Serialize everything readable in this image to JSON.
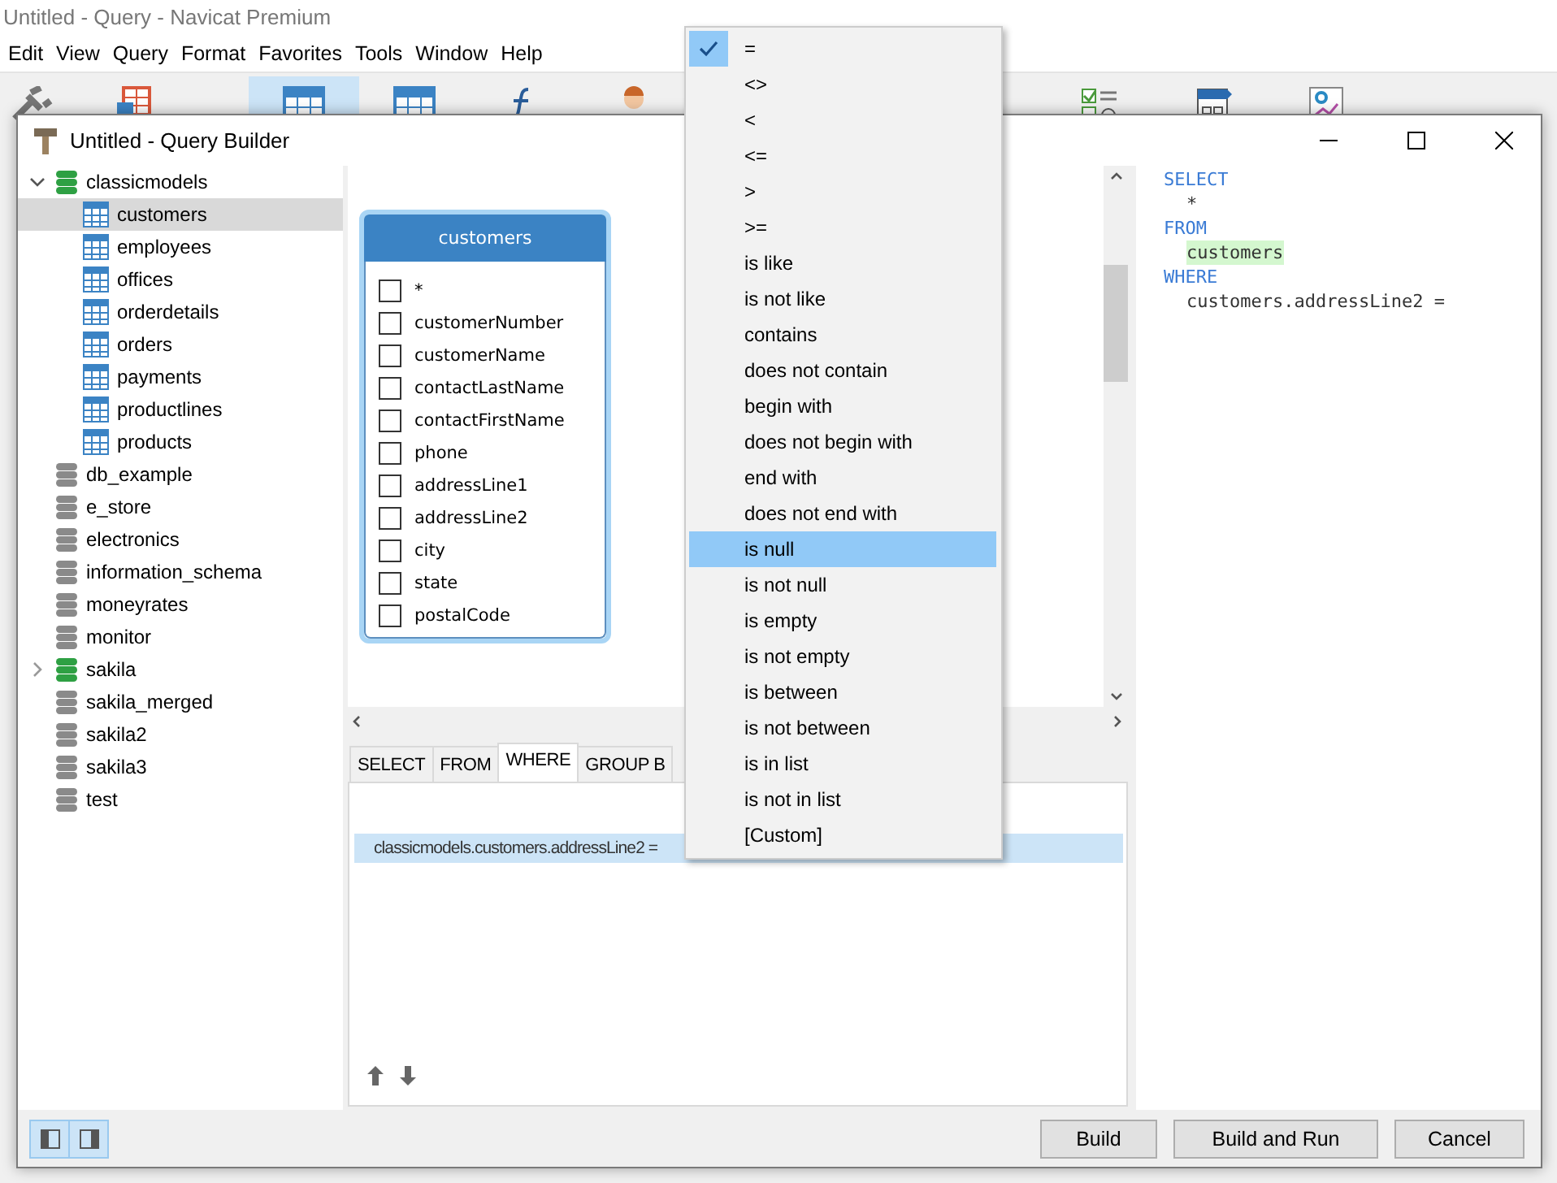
{
  "app_window": {
    "title": "Untitled - Query - Navicat Premium",
    "menu": [
      "Edit",
      "View",
      "Query",
      "Format",
      "Favorites",
      "Tools",
      "Window",
      "Help"
    ]
  },
  "dialog": {
    "title": "Untitled - Query Builder"
  },
  "tree": [
    {
      "label": "classicmodels",
      "open": true,
      "has_children": true,
      "expanded": true,
      "children": [
        {
          "label": "customers",
          "selected": true
        },
        {
          "label": "employees",
          "selected": false
        },
        {
          "label": "offices",
          "selected": false
        },
        {
          "label": "orderdetails",
          "selected": false
        },
        {
          "label": "orders",
          "selected": false
        },
        {
          "label": "payments",
          "selected": false
        },
        {
          "label": "productlines",
          "selected": false
        },
        {
          "label": "products",
          "selected": false
        }
      ]
    },
    {
      "label": "db_example",
      "open": false,
      "has_children": false
    },
    {
      "label": "e_store",
      "open": false,
      "has_children": false
    },
    {
      "label": "electronics",
      "open": false,
      "has_children": false
    },
    {
      "label": "information_schema",
      "open": false,
      "has_children": false
    },
    {
      "label": "moneyrates",
      "open": false,
      "has_children": false
    },
    {
      "label": "monitor",
      "open": false,
      "has_children": false
    },
    {
      "label": "sakila",
      "open": true,
      "has_children": true,
      "expanded": false
    },
    {
      "label": "sakila_merged",
      "open": false,
      "has_children": false
    },
    {
      "label": "sakila2",
      "open": false,
      "has_children": false
    },
    {
      "label": "sakila3",
      "open": false,
      "has_children": false
    },
    {
      "label": "test",
      "open": false,
      "has_children": false
    }
  ],
  "table_card": {
    "title": "customers",
    "fields": [
      {
        "name": "*",
        "checked": false
      },
      {
        "name": "customerNumber",
        "checked": false
      },
      {
        "name": "customerName",
        "checked": false
      },
      {
        "name": "contactLastName",
        "checked": false
      },
      {
        "name": "contactFirstName",
        "checked": false
      },
      {
        "name": "phone",
        "checked": false
      },
      {
        "name": "addressLine1",
        "checked": false
      },
      {
        "name": "addressLine2",
        "checked": false
      },
      {
        "name": "city",
        "checked": false
      },
      {
        "name": "state",
        "checked": false
      },
      {
        "name": "postalCode",
        "checked": false
      }
    ]
  },
  "clause_tabs": [
    {
      "label": "SELECT",
      "selected": false
    },
    {
      "label": "FROM",
      "selected": false
    },
    {
      "label": "WHERE",
      "selected": true
    },
    {
      "label": "GROUP B",
      "selected": false
    }
  ],
  "where_rows": [
    {
      "text": "classicmodels.customers.addressLine2 =",
      "selected": true
    }
  ],
  "sql": [
    {
      "text": "SELECT",
      "kind": "keyword"
    },
    {
      "text": "*",
      "kind": "item"
    },
    {
      "text": "FROM",
      "kind": "keyword"
    },
    {
      "text": "customers",
      "kind": "table"
    },
    {
      "text": "WHERE",
      "kind": "keyword"
    },
    {
      "text": "customers.addressLine2 =",
      "kind": "item"
    }
  ],
  "layout_toggles": [
    {
      "kind": "left",
      "selected": true
    },
    {
      "kind": "right",
      "selected": true
    }
  ],
  "buttons": [
    "Build",
    "Build and Run",
    "Cancel"
  ],
  "operator_menu": [
    {
      "label": "=",
      "selected": true,
      "highlighted": false
    },
    {
      "label": "<>",
      "selected": false,
      "highlighted": false
    },
    {
      "label": "<",
      "selected": false,
      "highlighted": false
    },
    {
      "label": "<=",
      "selected": false,
      "highlighted": false
    },
    {
      "label": ">",
      "selected": false,
      "highlighted": false
    },
    {
      "label": ">=",
      "selected": false,
      "highlighted": false
    },
    {
      "label": "is like",
      "selected": false,
      "highlighted": false
    },
    {
      "label": "is not like",
      "selected": false,
      "highlighted": false
    },
    {
      "label": "contains",
      "selected": false,
      "highlighted": false
    },
    {
      "label": "does not contain",
      "selected": false,
      "highlighted": false
    },
    {
      "label": "begin with",
      "selected": false,
      "highlighted": false
    },
    {
      "label": "does not begin with",
      "selected": false,
      "highlighted": false
    },
    {
      "label": "end with",
      "selected": false,
      "highlighted": false
    },
    {
      "label": "does not end with",
      "selected": false,
      "highlighted": false
    },
    {
      "label": "is null",
      "selected": false,
      "highlighted": true
    },
    {
      "label": "is not null",
      "selected": false,
      "highlighted": false
    },
    {
      "label": "is empty",
      "selected": false,
      "highlighted": false
    },
    {
      "label": "is not empty",
      "selected": false,
      "highlighted": false
    },
    {
      "label": "is between",
      "selected": false,
      "highlighted": false
    },
    {
      "label": "is not between",
      "selected": false,
      "highlighted": false
    },
    {
      "label": "is in list",
      "selected": false,
      "highlighted": false
    },
    {
      "label": "is not in list",
      "selected": false,
      "highlighted": false
    },
    {
      "label": "[Custom]",
      "selected": false,
      "highlighted": false
    }
  ]
}
